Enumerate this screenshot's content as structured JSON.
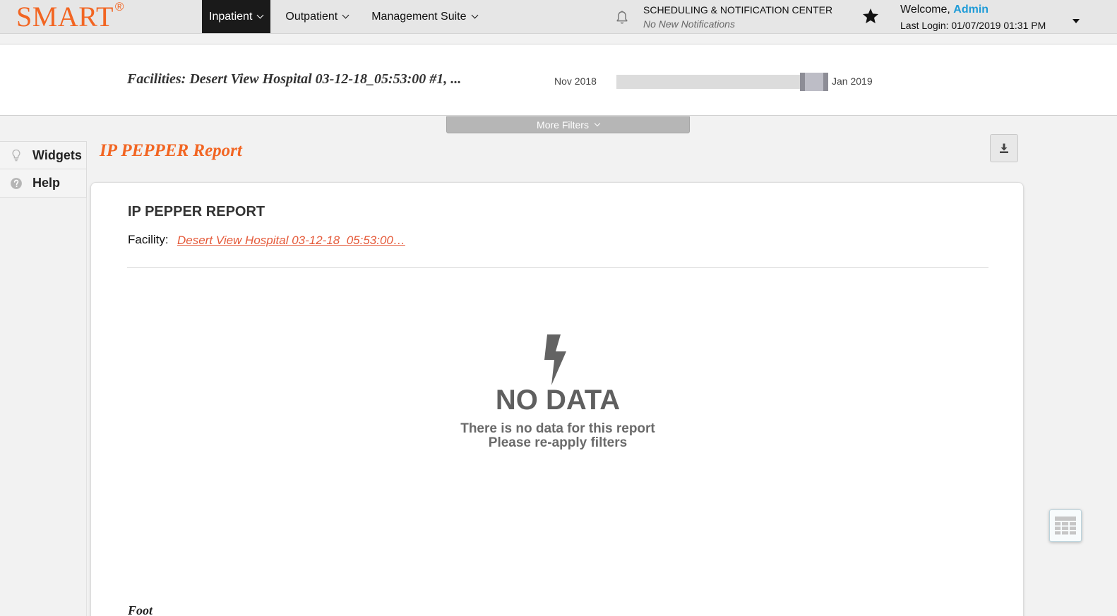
{
  "brand": {
    "name": "SMART",
    "mark": "®",
    "color": "#f26522"
  },
  "nav": {
    "items": [
      {
        "label": "Inpatient",
        "active": true
      },
      {
        "label": "Outpatient",
        "active": false
      },
      {
        "label": "Management Suite",
        "active": false
      }
    ]
  },
  "notifications": {
    "title": "SCHEDULING & NOTIFICATION CENTER",
    "status": "No New Notifications",
    "icon": "bell-icon"
  },
  "user": {
    "welcome_prefix": "Welcome, ",
    "name": "Admin",
    "last_login": "Last Login: 01/07/2019 01:31 PM",
    "favorite_icon": "star-icon"
  },
  "filters": {
    "facilities_text": "Facilities: Desert View Hospital 03-12-18_05:53:00 #1, ...",
    "range_start": "Nov 2018",
    "range_end": "Jan 2019",
    "more_filters_label": "More Filters"
  },
  "sidebar": {
    "items": [
      {
        "label": "Widgets",
        "icon": "lightbulb-icon"
      },
      {
        "label": "Help",
        "icon": "question-circle-icon"
      }
    ]
  },
  "report": {
    "page_title": "IP PEPPER Report",
    "card_title": "IP PEPPER REPORT",
    "facility_label": "Facility:",
    "facility_value": "Desert View Hospital 03-12-18_05:53:00…",
    "no_data_title": "NO DATA",
    "no_data_line1": "There is no data for this report",
    "no_data_line2": "Please re-apply filters",
    "footer_partial": "Foot"
  },
  "colors": {
    "accent": "#f26522",
    "link": "#e55a3a",
    "user": "#1e9bd7",
    "active_nav": "#1a1a1a"
  }
}
